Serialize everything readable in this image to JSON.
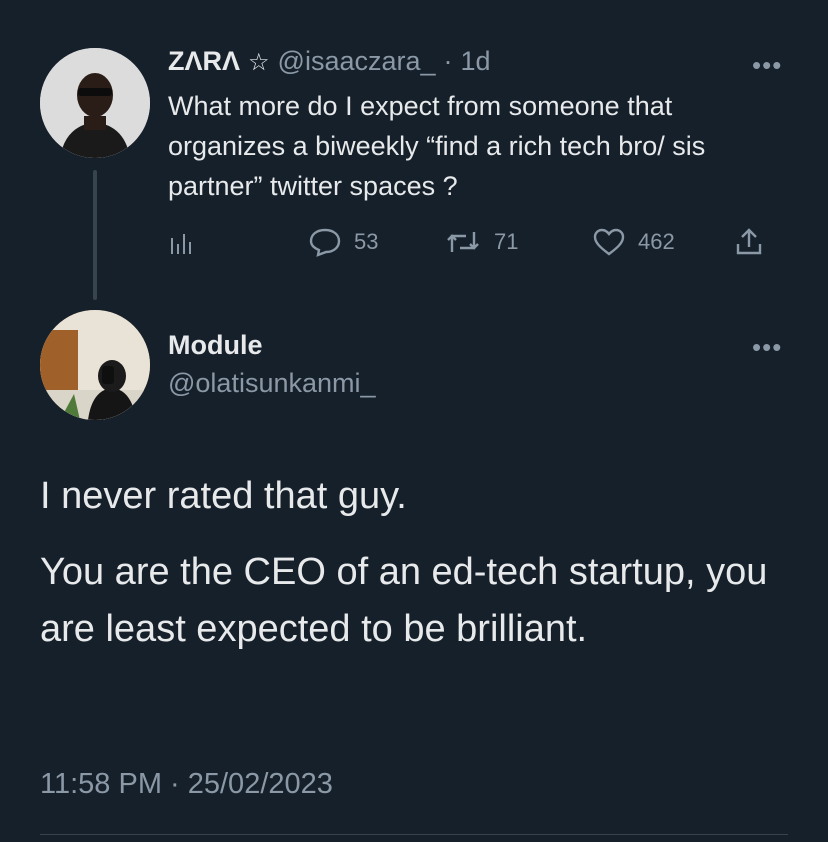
{
  "parent_tweet": {
    "display_name": "ZΛRΛ",
    "badge": "☆",
    "handle": "@isaaczara_",
    "time": "1d",
    "text": "What more do I expect from someone that organizes a biweekly “find a rich tech bro/ sis partner” twitter spaces ?",
    "more": "•••",
    "actions": {
      "replies": "53",
      "retweets": "71",
      "likes": "462"
    }
  },
  "reply_tweet": {
    "display_name": "Module",
    "handle": "@olatisunkanmi_",
    "more": "•••",
    "paragraph_1": "I never rated that guy.",
    "paragraph_2": "You are the CEO of an ed-tech startup, you are least expected to be brilliant.",
    "timestamp": "11:58 PM · 25/02/2023"
  },
  "icons": {
    "analytics": "analytics-icon",
    "reply": "reply-icon",
    "retweet": "retweet-icon",
    "like": "like-icon",
    "share": "share-icon"
  },
  "colors": {
    "background": "#15202b",
    "text": "#e7e9ea",
    "muted": "#8b98a5",
    "line": "#38444d"
  }
}
